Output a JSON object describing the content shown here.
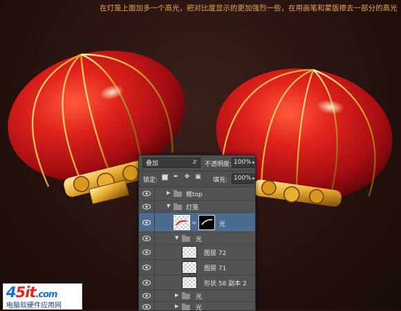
{
  "caption": "在灯笼上面加多一个高光，把对比度显示的更加强烈一些，在用画笔和蒙版擦去一部分的高光",
  "layers_panel": {
    "blend_mode": "叠加",
    "opacity_label": "不透明度:",
    "opacity_value": "100%",
    "lock_label": "锁定:",
    "fill_label": "填充:",
    "fill_value": "100%",
    "layers": [
      {
        "name": "框top",
        "kind": "group",
        "expanded": false,
        "indent": 0
      },
      {
        "name": "灯笼",
        "kind": "group",
        "expanded": true,
        "indent": 0
      },
      {
        "name": "光",
        "kind": "layer-with-mask",
        "selected": true,
        "indent": 1
      },
      {
        "name": "光",
        "kind": "group",
        "expanded": true,
        "indent": 1
      },
      {
        "name": "图层 72",
        "kind": "layer",
        "indent": 2
      },
      {
        "name": "图层 71",
        "kind": "layer",
        "indent": 2
      },
      {
        "name": "形状 58 副本 2",
        "kind": "layer",
        "indent": 2
      },
      {
        "name": "光",
        "kind": "group",
        "expanded": false,
        "indent": 1
      },
      {
        "name": "光",
        "kind": "group",
        "expanded": false,
        "indent": 1
      }
    ]
  },
  "watermark": {
    "brand_prefix": "4",
    "brand_main": "5it",
    "brand_suffix": ".com",
    "tagline": "电脑软硬件应用网"
  },
  "colors": {
    "caption": "#e6a548",
    "lantern_red": "#c0141a",
    "gold": "#f2c24a",
    "panel_bg": "#535353",
    "selected_layer": "#4b6b8f"
  }
}
